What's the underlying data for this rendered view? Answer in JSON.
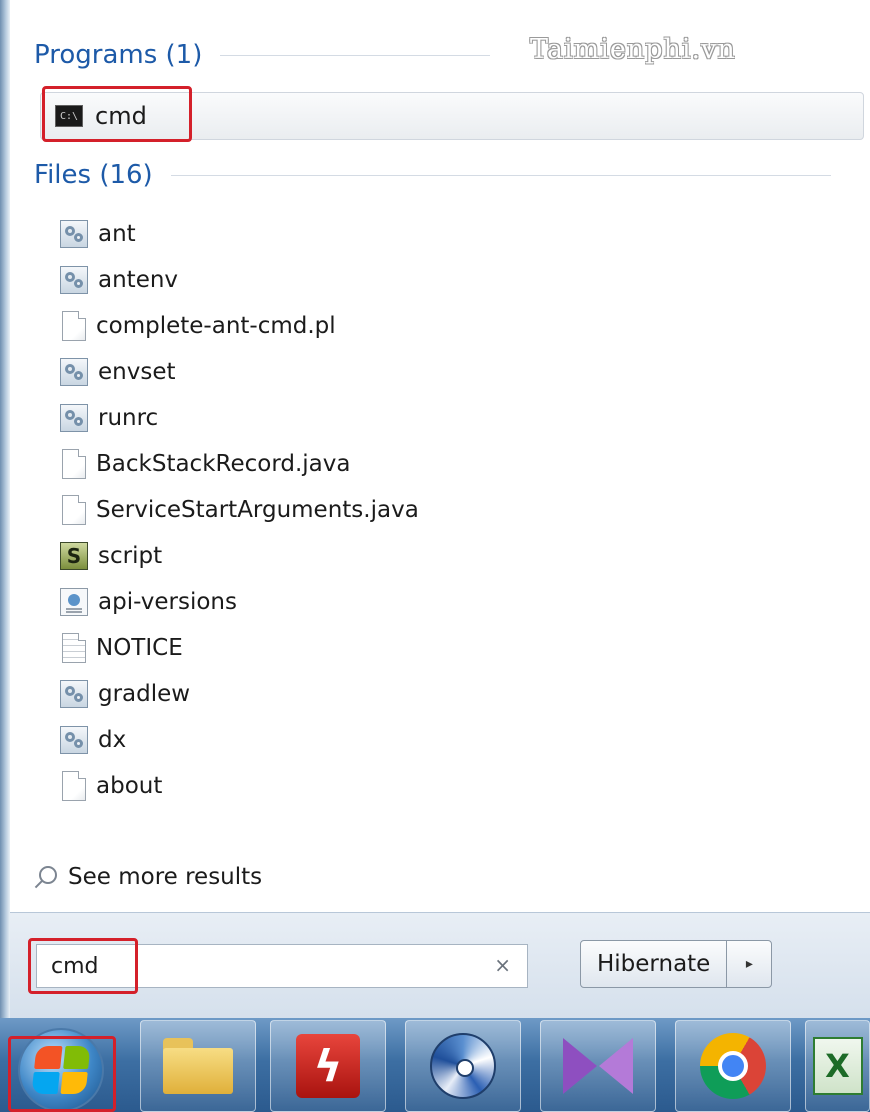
{
  "watermark": "Taimienphi.vn",
  "programs": {
    "heading": "Programs (1)",
    "items": [
      {
        "label": "cmd",
        "icon": "console-icon"
      }
    ]
  },
  "files": {
    "heading": "Files (16)",
    "items": [
      {
        "label": "ant",
        "icon": "batch-file-icon"
      },
      {
        "label": "antenv",
        "icon": "batch-file-icon"
      },
      {
        "label": "complete-ant-cmd.pl",
        "icon": "document-icon"
      },
      {
        "label": "envset",
        "icon": "batch-file-icon"
      },
      {
        "label": "runrc",
        "icon": "batch-file-icon"
      },
      {
        "label": "BackStackRecord.java",
        "icon": "document-icon"
      },
      {
        "label": "ServiceStartArguments.java",
        "icon": "document-icon"
      },
      {
        "label": "script",
        "icon": "script-file-icon"
      },
      {
        "label": "api-versions",
        "icon": "xml-file-icon"
      },
      {
        "label": "NOTICE",
        "icon": "text-file-icon"
      },
      {
        "label": "gradlew",
        "icon": "batch-file-icon"
      },
      {
        "label": "dx",
        "icon": "batch-file-icon"
      },
      {
        "label": "about",
        "icon": "document-icon"
      }
    ]
  },
  "see_more": "See more results",
  "search": {
    "value": "cmd",
    "clear_glyph": "×"
  },
  "power": {
    "label": "Hibernate",
    "arrow_glyph": "▸"
  },
  "taskbar": {
    "buttons": [
      {
        "name": "windows-explorer",
        "icon": "folder-icon"
      },
      {
        "name": "flash",
        "icon": "flash-icon"
      },
      {
        "name": "media-player",
        "icon": "disc-icon"
      },
      {
        "name": "visual-studio",
        "icon": "vs-icon"
      },
      {
        "name": "chrome",
        "icon": "chrome-icon"
      },
      {
        "name": "excel",
        "icon": "excel-icon",
        "glyph": "X"
      }
    ]
  },
  "highlight_color": "#d4202a",
  "heading_color": "#1d5aa8"
}
